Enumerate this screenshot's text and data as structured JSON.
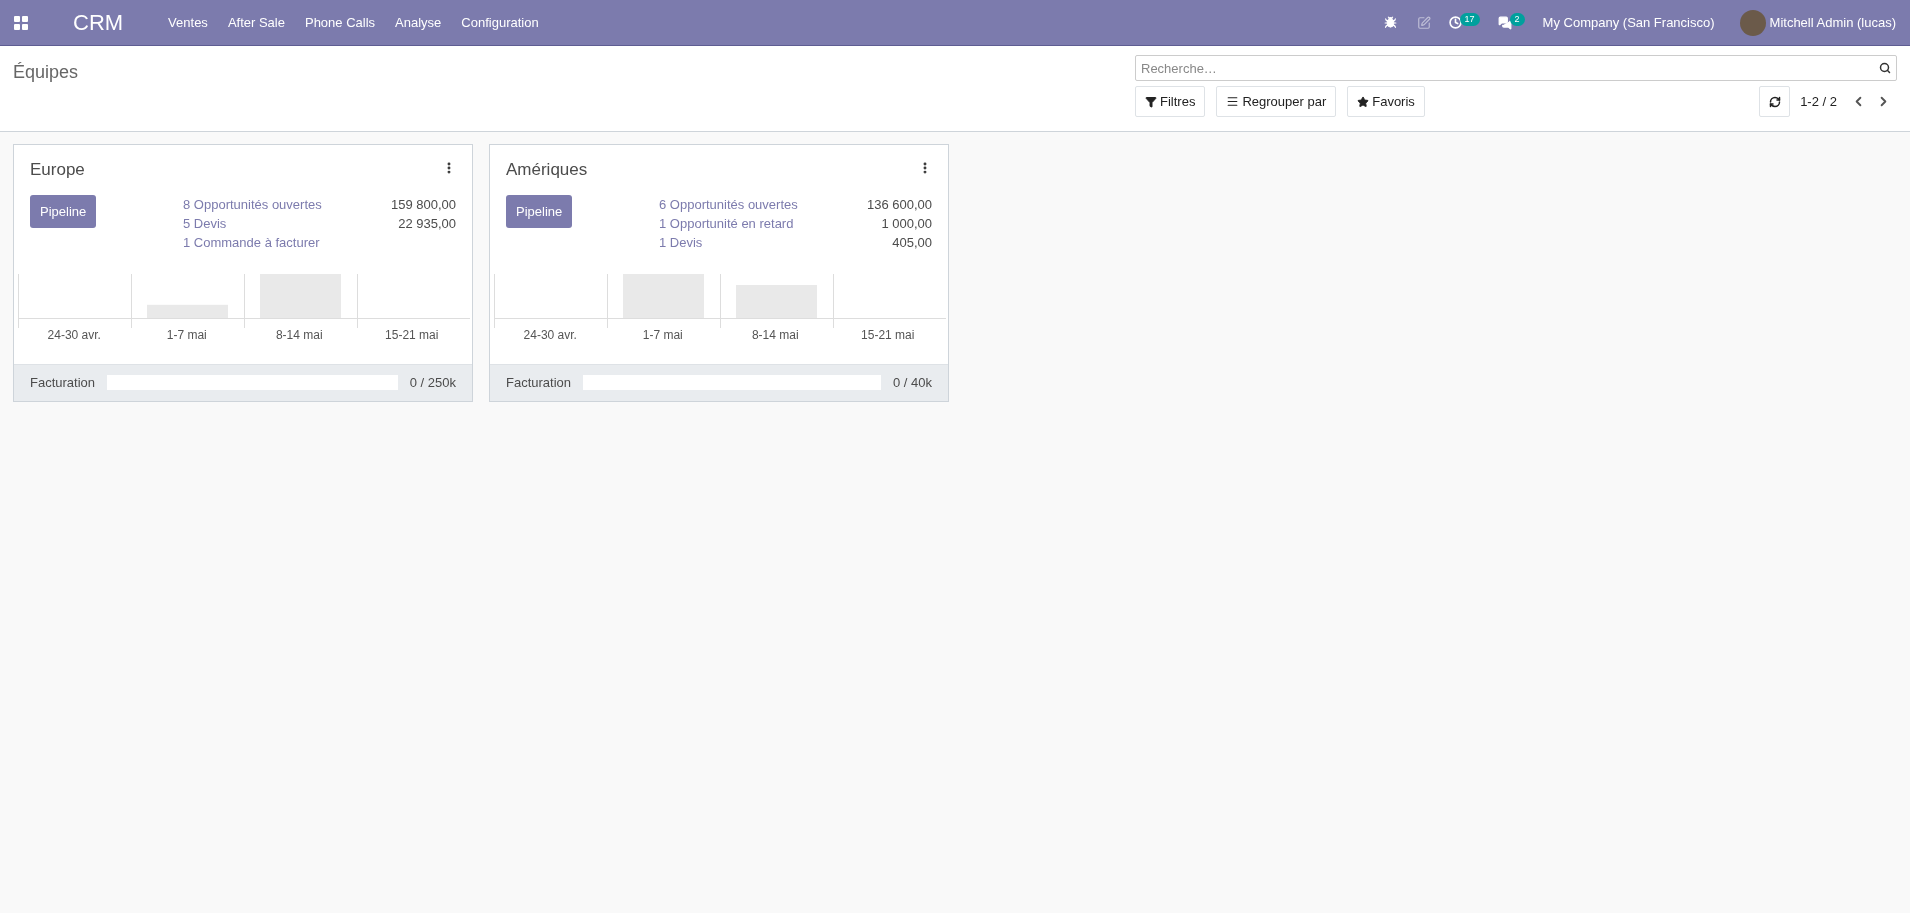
{
  "navbar": {
    "app_name": "CRM",
    "menu": [
      "Ventes",
      "After Sale",
      "Phone Calls",
      "Analyse",
      "Configuration"
    ],
    "activity_count": "17",
    "message_count": "2",
    "company": "My Company (San Francisco)",
    "user": "Mitchell Admin (lucas)"
  },
  "control_panel": {
    "breadcrumb": "Équipes",
    "search": {
      "placeholder": "Recherche…"
    },
    "buttons": [
      {
        "kind": "filter",
        "label": "Filtres"
      },
      {
        "kind": "group",
        "label": "Regrouper par"
      },
      {
        "kind": "favorite",
        "label": "Favoris"
      }
    ],
    "pager": "1-2 / 2"
  },
  "teams": [
    {
      "name": "Europe",
      "button": "Pipeline",
      "stats": [
        {
          "label": "8 Opportunités ouvertes",
          "value": "159 800,00"
        },
        {
          "label": "5 Devis",
          "value": "22 935,00"
        },
        {
          "label": "1 Commande à facturer"
        }
      ],
      "weeks": [
        "24-30 avr.",
        "1-7 mai",
        "8-14 mai",
        "15-21 mai"
      ],
      "progress": {
        "label": "Facturation",
        "level": 0,
        "reading": "0 / 250k"
      }
    },
    {
      "name": "Amériques",
      "button": "Pipeline",
      "stats": [
        {
          "label": "6 Opportunités ouvertes",
          "value": "136 600,00"
        },
        {
          "label": "1 Opportunité en retard",
          "value": "1 000,00"
        },
        {
          "label": "1 Devis",
          "value": "405,00"
        }
      ],
      "weeks": [
        "24-30 avr.",
        "1-7 mai",
        "8-14 mai",
        "15-21 mai"
      ],
      "progress": {
        "label": "Facturation",
        "level": 0,
        "reading": "0 / 40k"
      }
    }
  ]
}
